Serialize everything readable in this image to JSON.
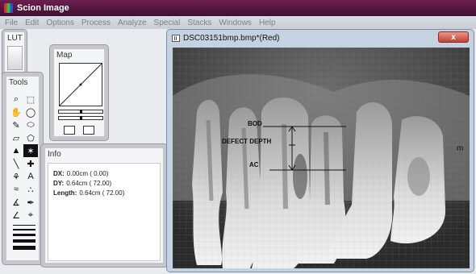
{
  "app": {
    "title": "Scion Image"
  },
  "menu": [
    "File",
    "Edit",
    "Options",
    "Process",
    "Analyze",
    "Special",
    "Stacks",
    "Windows",
    "Help"
  ],
  "lut": {
    "title": "LUT"
  },
  "tools": {
    "title": "Tools",
    "items": [
      {
        "name": "magnifier-icon",
        "glyph": "⌕"
      },
      {
        "name": "rect-select-icon",
        "glyph": "⬚"
      },
      {
        "name": "hand-icon",
        "glyph": "✋"
      },
      {
        "name": "oval-select-icon",
        "glyph": "◯"
      },
      {
        "name": "pencil-icon",
        "glyph": "✎"
      },
      {
        "name": "freehand-select-icon",
        "glyph": "⬭"
      },
      {
        "name": "eraser-icon",
        "glyph": "▱"
      },
      {
        "name": "polygon-select-icon",
        "glyph": "⬠"
      },
      {
        "name": "paint-bucket-icon",
        "glyph": "▲"
      },
      {
        "name": "wand-icon",
        "glyph": "✶"
      },
      {
        "name": "line-icon",
        "glyph": "╲"
      },
      {
        "name": "crosshair-icon",
        "glyph": "✚"
      },
      {
        "name": "fill-icon",
        "glyph": "⚘"
      },
      {
        "name": "text-icon",
        "glyph": "A"
      },
      {
        "name": "profile-icon",
        "glyph": "≈"
      },
      {
        "name": "spray-icon",
        "glyph": "∴"
      },
      {
        "name": "angle-icon",
        "glyph": "∡"
      },
      {
        "name": "dropper-icon",
        "glyph": "✒"
      },
      {
        "name": "angle-tool-icon",
        "glyph": "∠"
      },
      {
        "name": "target-icon",
        "glyph": "⌖"
      }
    ]
  },
  "map": {
    "title": "Map"
  },
  "info": {
    "title": "Info",
    "rows": [
      {
        "label": "DX:",
        "value": "0.00cm ( 0.00)"
      },
      {
        "label": "DY:",
        "value": "0.64cm ( 72.00)"
      },
      {
        "label": "Length:",
        "value": "0.64cm ( 72.00)"
      }
    ]
  },
  "image_window": {
    "title": "DSC03151bmp.bmp*(Red)",
    "close": "x",
    "labels": {
      "bod": "BOD",
      "defect": "DEFECT DEPTH",
      "ac": "AC",
      "m": "m"
    }
  }
}
